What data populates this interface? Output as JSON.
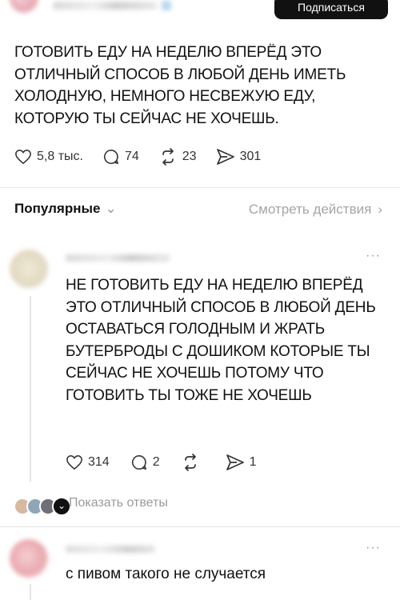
{
  "header": {
    "follow_label": "Подписаться"
  },
  "post": {
    "text": "ГОТОВИТЬ ЕДУ НА НЕДЕЛЮ ВПЕРЁД ЭТО ОТЛИЧНЫЙ СПОСОБ В ЛЮБОЙ ДЕНЬ ИМЕТЬ ХОЛОДНУЮ, НЕМНОГО НЕСВЕЖУЮ ЕДУ, КОТОРУЮ ТЫ СЕЙЧАС НЕ ХОЧЕШЬ.",
    "likes": "5,8 тыс.",
    "comments": "74",
    "reposts": "23",
    "shares": "301"
  },
  "filter": {
    "sort_label": "Популярные",
    "sort_chevron": "⌄",
    "actions_label": "Смотреть действия",
    "actions_chevron": "›"
  },
  "comment1": {
    "more": "···",
    "text": "НЕ ГОТОВИТЬ ЕДУ НА НЕДЕЛЮ ВПЕРЁД ЭТО ОТЛИЧНЫЙ СПОСОБ В ЛЮБОЙ ДЕНЬ ОСТАВАТЬСЯ ГОЛОДНЫМ И ЖРАТЬ БУТЕРБРОДЫ С ДОШИКОМ КОТОРЫЕ ТЫ СЕЙЧАС НЕ ХОЧЕШЬ ПОТОМУ ЧТО ГОТОВИТЬ ТЫ ТОЖЕ НЕ ХОЧЕШЬ",
    "likes": "314",
    "comments": "2",
    "reposts": "",
    "shares": "1",
    "show_replies": "Показать ответы"
  },
  "comment2": {
    "more": "···",
    "text": "с пивом такого не случается"
  },
  "icons": {
    "like": "heart-icon",
    "comment": "comment-icon",
    "repost": "repost-icon",
    "share": "share-icon"
  }
}
